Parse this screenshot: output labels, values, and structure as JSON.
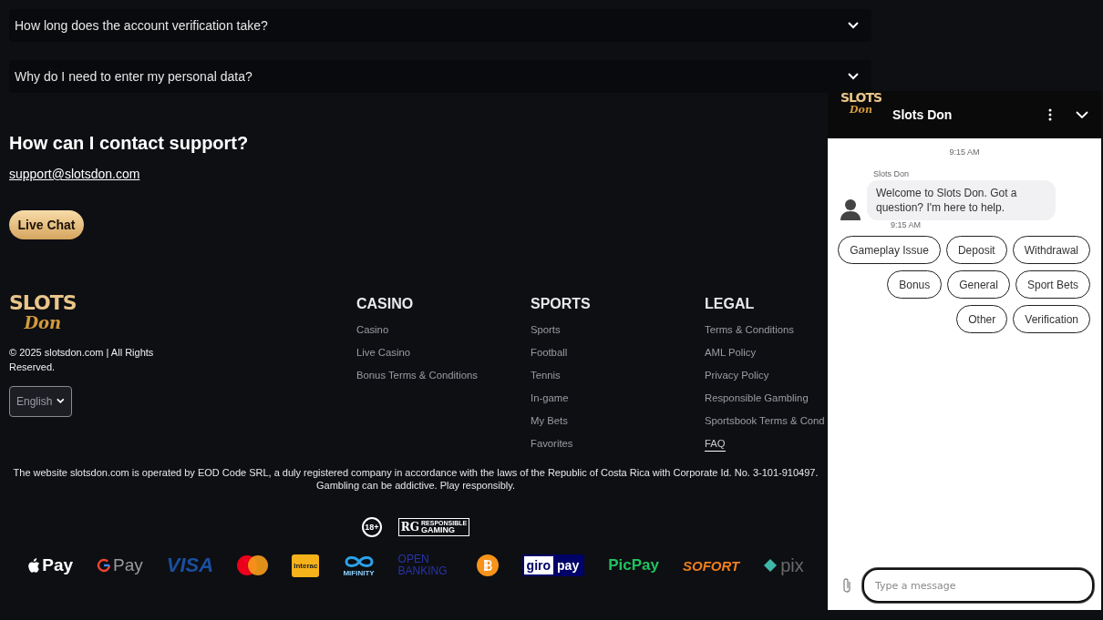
{
  "faq": [
    {
      "question": "How long does the account verification take?",
      "expanded": false
    },
    {
      "question": "Why do I need to enter my personal data?",
      "expanded": false
    }
  ],
  "contact": {
    "heading": "How can I contact support?",
    "email": "support@slotsdon.com",
    "button": "Live Chat"
  },
  "footer": {
    "logo": {
      "top": "SLOTS",
      "bottom": "Don"
    },
    "copyright": "© 2025 slotsdon.com | All Rights Reserved.",
    "language": "English",
    "columns": [
      {
        "title": "CASINO",
        "links": [
          {
            "label": "Casino",
            "selected": false
          },
          {
            "label": "Live Casino",
            "selected": false
          },
          {
            "label": "Bonus Terms & Conditions",
            "selected": false
          }
        ]
      },
      {
        "title": "SPORTS",
        "links": [
          {
            "label": "Sports",
            "selected": false
          },
          {
            "label": "Football",
            "selected": false
          },
          {
            "label": "Tennis",
            "selected": false
          },
          {
            "label": "In-game",
            "selected": false
          },
          {
            "label": "My Bets",
            "selected": false
          },
          {
            "label": "Favorites",
            "selected": false
          }
        ]
      },
      {
        "title": "LEGAL",
        "links": [
          {
            "label": "Terms & Conditions",
            "selected": false
          },
          {
            "label": "AML Policy",
            "selected": false
          },
          {
            "label": "Privacy Policy",
            "selected": false
          },
          {
            "label": "Responsible Gambling",
            "selected": false
          },
          {
            "label": "Sportsbook Terms & Cond",
            "selected": false
          },
          {
            "label": "FAQ",
            "selected": true
          }
        ]
      }
    ]
  },
  "disclaimer": [
    "The website slotsdon.com is operated by EOD Code SRL, a duly registered company in accordance with the laws of the Republic of Costa Rica with Corporate Id. No. 3-101-910497.",
    "Gambling can be addictive. Play responsibly."
  ],
  "badges": [
    {
      "kind": "age",
      "label": "18+"
    },
    {
      "kind": "rg",
      "label": "RG",
      "top": "RESPONSIBLE",
      "bottom": "GAMING"
    }
  ],
  "payments": [
    {
      "kind": "applepay",
      "label": "Pay"
    },
    {
      "kind": "gpay",
      "label": "Pay"
    },
    {
      "kind": "visa",
      "label": "VISA"
    },
    {
      "kind": "mastercard"
    },
    {
      "kind": "interac",
      "label": "Interac"
    },
    {
      "kind": "mifinity",
      "label": "MiFINITY"
    },
    {
      "kind": "openbanking",
      "label": "OPEN BANKING"
    },
    {
      "kind": "bitcoin"
    },
    {
      "kind": "giropay",
      "label": "giro",
      "second": "pay"
    },
    {
      "kind": "picpay",
      "label": "PicPay"
    },
    {
      "kind": "sofort",
      "label": "SOFORT"
    },
    {
      "kind": "pix",
      "label": "pix"
    }
  ],
  "chat": {
    "title": "Slots Don",
    "logo": {
      "top": "SLOTS",
      "bottom": "Don"
    },
    "time": "9:15 AM",
    "sender": "Slots Don",
    "message": "Welcome to Slots Don. Got a question? I'm here to help.",
    "message_time": "9:15 AM",
    "quick_replies": [
      [
        "Gameplay Issue",
        "Deposit",
        "Withdrawal"
      ],
      [
        "Bonus",
        "General",
        "Sport Bets"
      ],
      [
        "Other",
        "Verification"
      ]
    ],
    "input": {
      "placeholder": "Type a message",
      "focused": true
    }
  }
}
